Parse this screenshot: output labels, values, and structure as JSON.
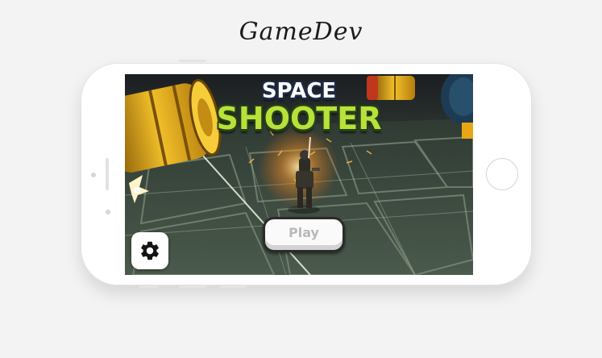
{
  "header": {
    "brand": "GameDev"
  },
  "game": {
    "title_line1": "SPACE",
    "title_line2": "SHOOTER",
    "play_label": "Play",
    "settings_icon": "gear-icon"
  },
  "colors": {
    "page_background": "#f3f3f3",
    "phone_body": "#ffffff",
    "title_white": "#ffffff",
    "title_green": "#b8e23a",
    "play_text": "#b9b9b9",
    "barrel_yellow": "#e7b21a"
  }
}
